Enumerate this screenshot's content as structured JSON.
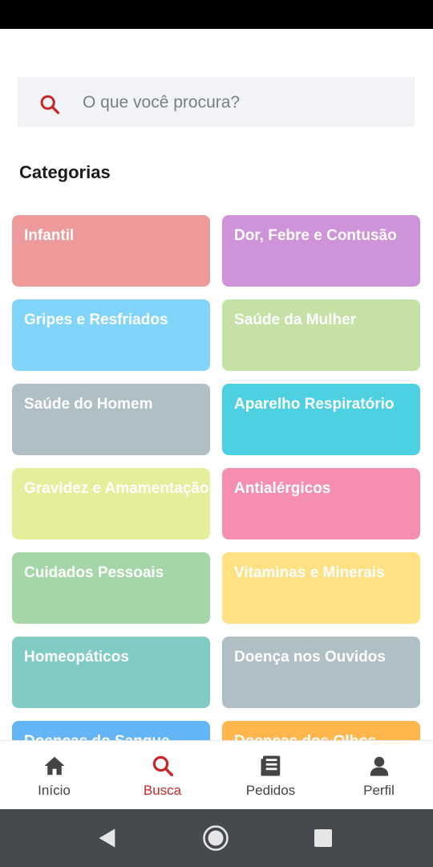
{
  "search": {
    "placeholder": "O que você procura?"
  },
  "section_title": "Categorias",
  "categories": [
    {
      "label": "Infantil",
      "color": "#ef9a9a"
    },
    {
      "label": "Dor, Febre e Contusão",
      "color": "#ce93d8"
    },
    {
      "label": "Gripes e Resfriados",
      "color": "#81d4fa"
    },
    {
      "label": "Saúde da Mulher",
      "color": "#c5e1a5"
    },
    {
      "label": "Saúde do Homem",
      "color": "#b0bec5"
    },
    {
      "label": "Aparelho Respiratório",
      "color": "#4dd0e1"
    },
    {
      "label": "Gravidez e Amamentação",
      "color": "#e6ee9c"
    },
    {
      "label": "Antialérgicos",
      "color": "#f48fb1"
    },
    {
      "label": "Cuidados Pessoais",
      "color": "#a5d6a7"
    },
    {
      "label": "Vitaminas e Minerais",
      "color": "#ffe082"
    },
    {
      "label": "Homeopáticos",
      "color": "#80cbc4"
    },
    {
      "label": "Doença nos Ouvidos",
      "color": "#b0bec5"
    },
    {
      "label": "Doenças do Sangue",
      "color": "#64b5f6"
    },
    {
      "label": "Doenças dos Olhos",
      "color": "#ffb74d"
    }
  ],
  "bottom_nav": [
    {
      "label": "Início",
      "icon": "home-icon",
      "active": false
    },
    {
      "label": "Busca",
      "icon": "search-icon",
      "active": true
    },
    {
      "label": "Pedidos",
      "icon": "orders-icon",
      "active": false
    },
    {
      "label": "Perfil",
      "icon": "profile-icon",
      "active": false
    }
  ],
  "system_nav": [
    "back-icon",
    "home-circle-icon",
    "recents-icon"
  ],
  "colors": {
    "accent": "#c62828",
    "nav_inactive": "#444444"
  }
}
